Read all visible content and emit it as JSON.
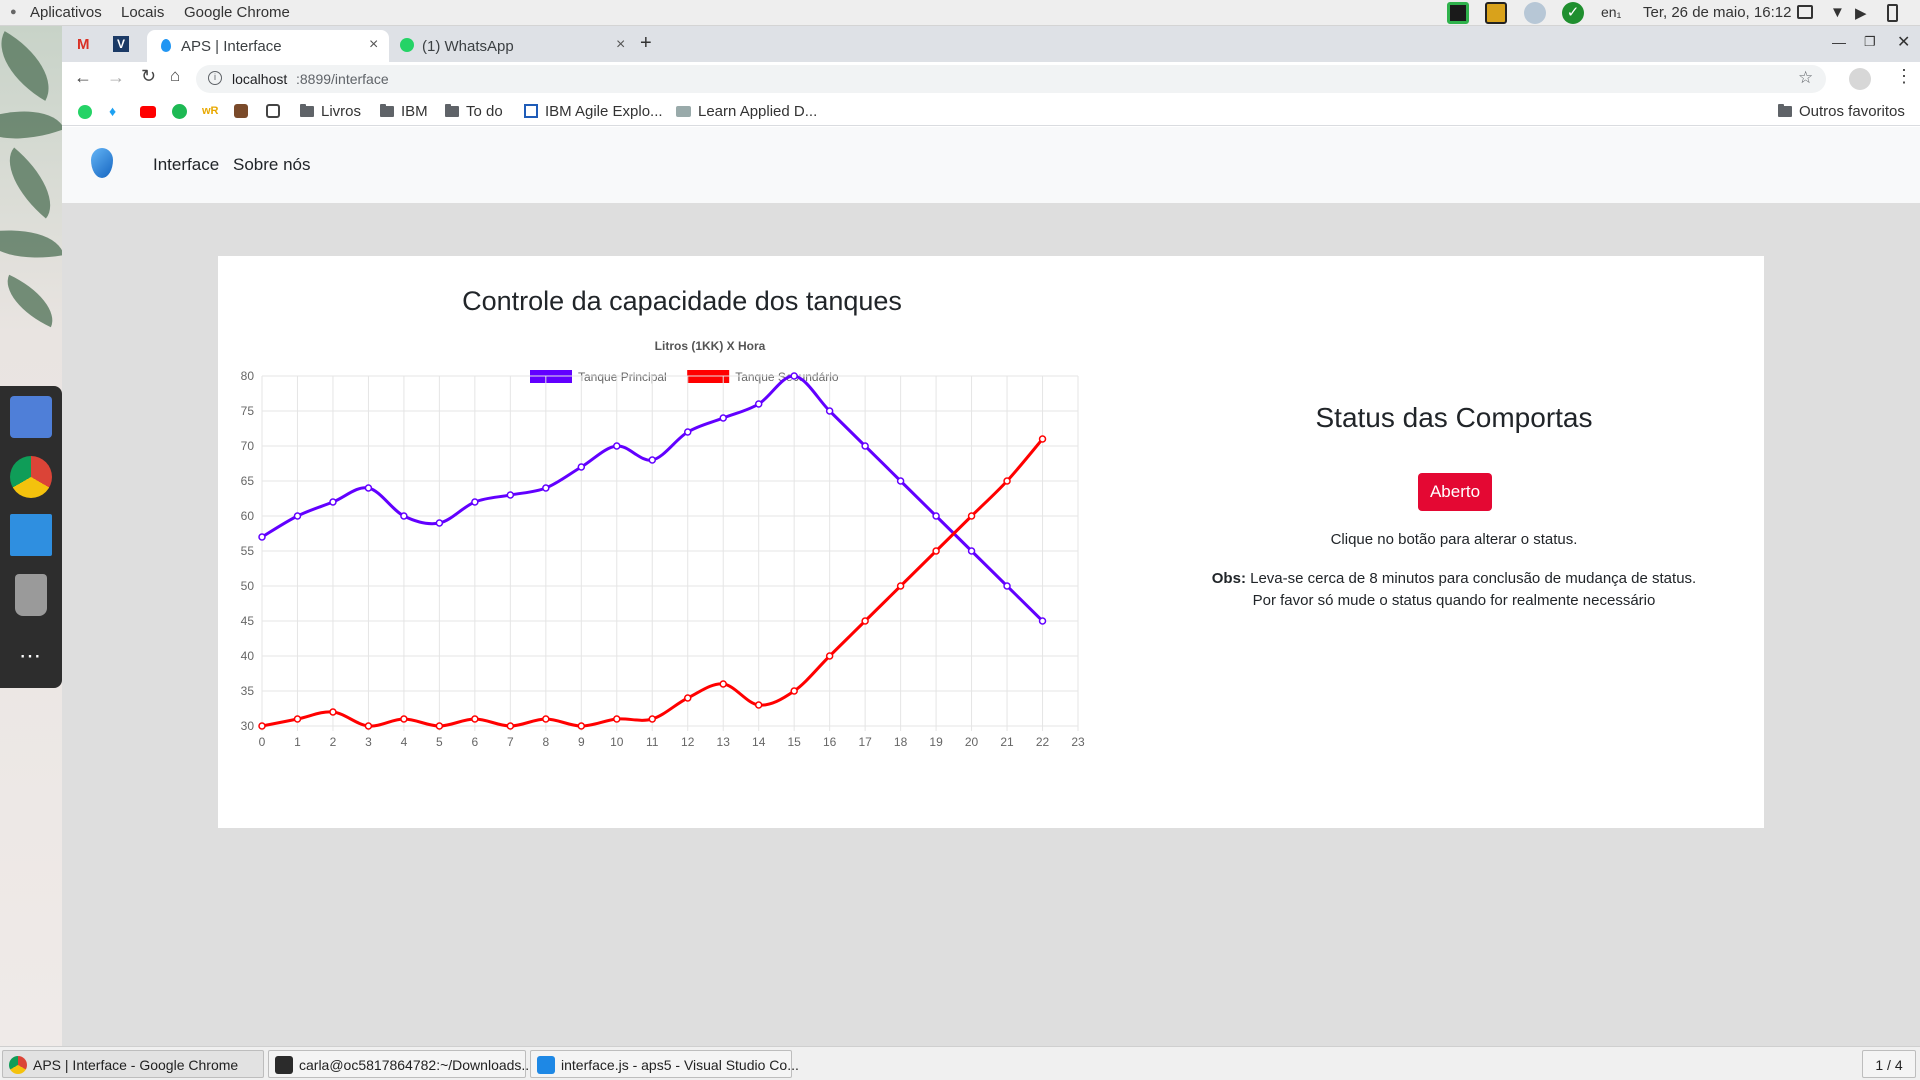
{
  "topbar": {
    "menu_apps": "Aplicativos",
    "menu_places": "Locais",
    "menu_app": "Google Chrome",
    "keyboard": "en₁",
    "clock": "Ter, 26 de maio, 16:12"
  },
  "chrome": {
    "tabs": [
      {
        "title": "",
        "icon": "gmail-icon"
      },
      {
        "title": "",
        "icon": "v-icon"
      },
      {
        "title": "APS | Interface",
        "icon": "droplet-icon",
        "close": "×"
      },
      {
        "title": "(1) WhatsApp",
        "icon": "whatsapp-icon",
        "close": "×"
      }
    ],
    "new_tab": "+",
    "url_host": "localhost",
    "url_rest": ":8899/interface",
    "bookmarks": [
      {
        "label": "Livros"
      },
      {
        "label": "IBM"
      },
      {
        "label": "To do"
      },
      {
        "label": "IBM Agile Explo..."
      },
      {
        "label": "Learn Applied D..."
      }
    ],
    "other_bookmarks": "Outros favoritos"
  },
  "nav": {
    "link_interface": "Interface",
    "link_about": "Sobre nós"
  },
  "main": {
    "chart_heading": "Controle da capacidade dos tanques",
    "status_heading": "Status das Comportas",
    "status_button": "Aberto",
    "status_hint": "Clique no botão para alterar o status.",
    "obs_label": "Obs:",
    "obs_line1": "Leva-se cerca de 8 minutos para conclusão de mudança de status.",
    "obs_line2": "Por favor só mude o status quando for realmente necessário"
  },
  "chart_data": {
    "type": "line",
    "title": "Litros (1KK) X Hora",
    "x": [
      0,
      1,
      2,
      3,
      4,
      5,
      6,
      7,
      8,
      9,
      10,
      11,
      12,
      13,
      14,
      15,
      16,
      17,
      18,
      19,
      20,
      21,
      22,
      23
    ],
    "ylim": [
      30,
      80
    ],
    "yticks": [
      30,
      35,
      40,
      45,
      50,
      55,
      60,
      65,
      70,
      75,
      80
    ],
    "grid": true,
    "legend": "top",
    "series": [
      {
        "name": "Tanque Principal",
        "color": "#6200ff",
        "values": [
          57,
          60,
          62,
          64,
          60,
          59,
          62,
          63,
          64,
          67,
          70,
          68,
          72,
          74,
          76,
          80,
          75,
          70,
          65,
          60,
          55,
          50,
          45
        ]
      },
      {
        "name": "Tanque Secundário",
        "color": "#ff0000",
        "values": [
          30,
          31,
          32,
          30,
          31,
          30,
          31,
          30,
          31,
          30,
          31,
          31,
          34,
          36,
          33,
          35,
          40,
          45,
          50,
          55,
          60,
          65,
          71
        ]
      }
    ]
  },
  "taskbar": {
    "items": [
      {
        "label": "APS | Interface - Google Chrome"
      },
      {
        "label": "carla@oc5817864782:~/Downloads..."
      },
      {
        "label": "interface.js - aps5 - Visual Studio Co..."
      }
    ],
    "workspace": "1 / 4"
  }
}
